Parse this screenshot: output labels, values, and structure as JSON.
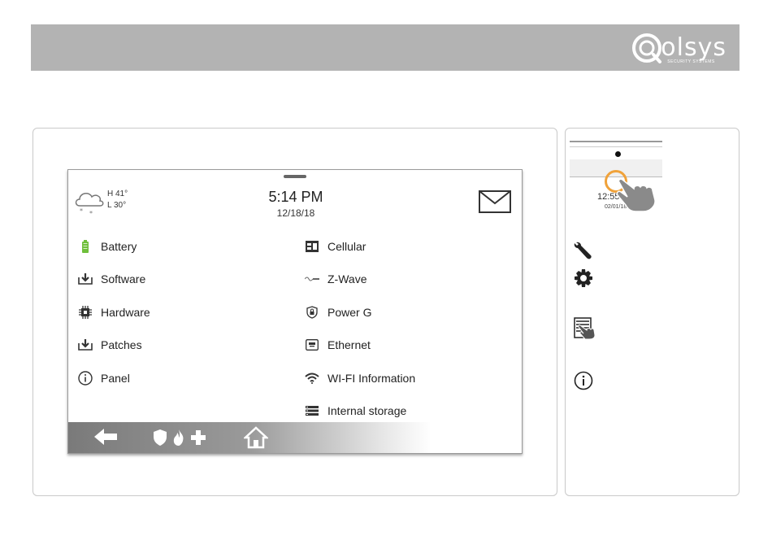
{
  "brand": {
    "name": "olsys",
    "subtitle": "SECURITY SYSTEMS"
  },
  "panel": {
    "weather": {
      "high": "H 41°",
      "low": "L 30°",
      "icon": "cloud-snow-icon"
    },
    "clock": {
      "time": "5:14 PM",
      "date": "12/18/18"
    },
    "left_menu": [
      {
        "label": "Battery",
        "icon": "battery-icon"
      },
      {
        "label": "Software",
        "icon": "download-tray-icon"
      },
      {
        "label": "Hardware",
        "icon": "chip-icon"
      },
      {
        "label": "Patches",
        "icon": "download-tray-icon"
      },
      {
        "label": "Panel",
        "icon": "info-icon"
      }
    ],
    "right_menu": [
      {
        "label": "Cellular",
        "icon": "cellular-icon"
      },
      {
        "label": "Z-Wave",
        "icon": "zwave-icon"
      },
      {
        "label": "Power G",
        "icon": "shield-lock-icon"
      },
      {
        "label": "Ethernet",
        "icon": "ethernet-icon"
      },
      {
        "label": "WI-FI Information",
        "icon": "wifi-icon"
      },
      {
        "label": "Internal storage",
        "icon": "storage-icon"
      }
    ],
    "nav": [
      "back-arrow-icon",
      "shield-icon",
      "fire-icon",
      "medical-cross-icon",
      "home-icon"
    ]
  },
  "side": {
    "time": "12:55",
    "date": "02/01/18"
  },
  "colors": {
    "header": "#b3b3b3",
    "accent_orange": "#f0a23a",
    "battery_green": "#6fbf3b"
  }
}
